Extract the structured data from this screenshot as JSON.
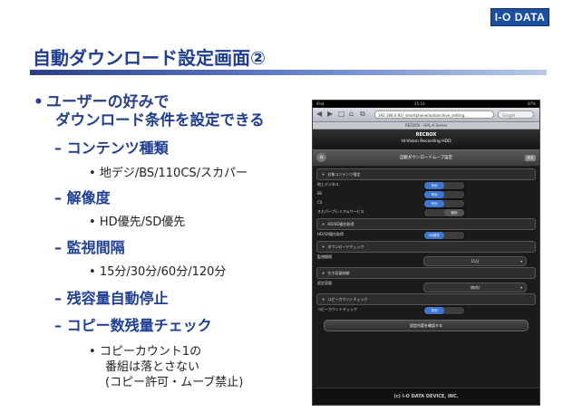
{
  "brand": {
    "logo_text": "I-O DATA"
  },
  "slide": {
    "title": "自動ダウンロード設定画面②",
    "bullet_intro": [
      "ユーザーの好みで",
      "ダウンロード条件を設定できる"
    ],
    "items": [
      {
        "heading": "コンテンツ種類",
        "details": [
          "地デジ/BS/110CS/スカパー"
        ]
      },
      {
        "heading": "解像度",
        "details": [
          "HD優先/SD優先"
        ]
      },
      {
        "heading": "監視間隔",
        "details": [
          "15分/30分/60分/120分"
        ]
      },
      {
        "heading": "残容量自動停止",
        "details": []
      },
      {
        "heading": "コピー数残量チェック",
        "details": [
          "コピーカウント1の",
          "番組は落とさない",
          "(コピー許可・ムーブ禁止)"
        ]
      }
    ],
    "bullet_symbol": "•",
    "dash_symbol": "–"
  },
  "tablet": {
    "status_left": "iPad",
    "status_time": "15:10",
    "status_right": "87%",
    "nav_back": "◀",
    "nav_forward": "▶",
    "nav_bookmark": "□",
    "nav_home": "⌂",
    "nav_tabs": "⧉",
    "url": "192.168.0.92/_smartphone/autoarchive_setting...",
    "search_placeholder": "Google",
    "page_title": "RECBOX - HVL-A Series",
    "app_title": "RECBOX",
    "app_subtitle": "Hi-Vision Recording HDD",
    "toolbar_title": "自動ダウンロードムーブ設定",
    "home_glyph": "⌂",
    "back_label": "戻る",
    "plus_glyph": "+",
    "sections": {
      "content": "対象コンテンツ指定",
      "hdsd": "HD/SD優先取得",
      "interval": "ダウンロードチェック",
      "capacity": "空き容量制御",
      "copy": "コピーカウントチェック"
    },
    "rows": {
      "terrestrial": "地上デジタル",
      "bs": "BS",
      "cs": "CS",
      "skyperfect": "スカパープレミアムサービス",
      "hdsd_label": "HD/SD優先取得",
      "interval_label": "監視間隔",
      "capacity_label": "設定容量",
      "copy_label": "コピーカウントチェック"
    },
    "toggle_on": "有効",
    "toggle_off": "無効",
    "hd_priority": "HD優先",
    "interval_value": "15分",
    "capacity_value": "(無効)",
    "select_arrow": "▾",
    "confirm_button": "設定内容を確認する",
    "footer": "(c) I-O DATA DEVICE, INC."
  }
}
